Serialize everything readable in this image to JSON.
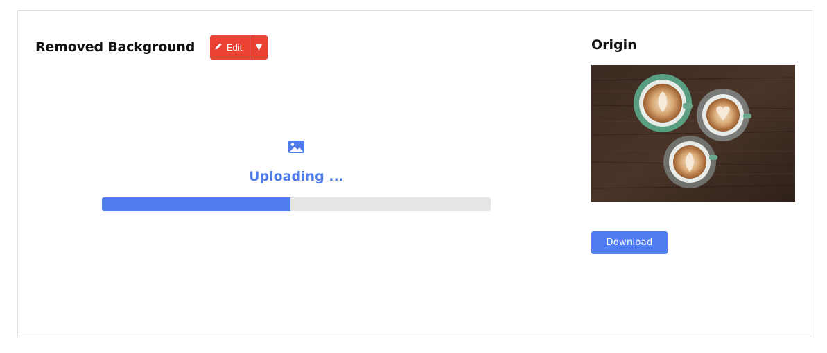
{
  "result_panel": {
    "title": "Removed Background",
    "edit_label": "Edit",
    "upload_status": "Uploading ...",
    "upload_progress": 0.485
  },
  "origin_panel": {
    "title": "Origin",
    "download_label": "Download"
  },
  "colors": {
    "accent_blue": "#4f7cf0",
    "edit_red": "#ea4335",
    "progress_track": "#e5e5e5"
  },
  "icons": {
    "edit": "pencil-icon",
    "dropdown": "triangle-down-icon",
    "upload": "image-icon"
  }
}
